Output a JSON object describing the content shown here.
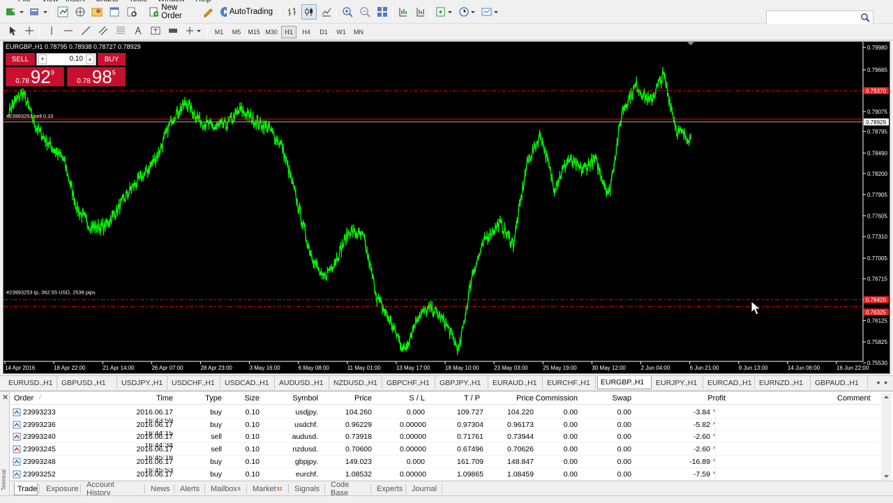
{
  "menu": [
    "File",
    "View",
    "Insert",
    "Charts",
    "Tools",
    "Window",
    "Help"
  ],
  "toolbar": {
    "new_order": "New Order",
    "auto_trading": "AutoTrading",
    "timeframes": [
      "M1",
      "M5",
      "M15",
      "M30",
      "H1",
      "H4",
      "D1",
      "W1",
      "MN"
    ],
    "active_timeframe": "H1"
  },
  "search": {
    "placeholder": ""
  },
  "chart": {
    "title": "EURGBP.,H1  0.78795 0.78938 0.78727 0.78929",
    "one_click": {
      "sell_label": "SELL",
      "buy_label": "BUY",
      "lot": "0.10",
      "sell_small": "0.78",
      "sell_big": "92",
      "sell_pip": "9",
      "buy_small": "0.78",
      "buy_big": "98",
      "buy_pip": "5"
    },
    "order_line_label": "#23993253 sell 0.10",
    "tp_line_label": "#23993253 tp, 362.55 USD, 2538 pips",
    "colors": {
      "background": "#000000",
      "candles": "#00ff00",
      "order_line": "#ff0000",
      "tp_line": "#ff0000",
      "bid_line": "#ffffff"
    }
  },
  "chart_data": {
    "type": "line",
    "title": "EURGBP.,H1",
    "y_ticks": [
      "0.79980",
      "0.79665",
      "0.79370",
      "0.79075",
      "0.78795",
      "0.78490",
      "0.78200",
      "0.77905",
      "0.77605",
      "0.77310",
      "0.77005",
      "0.76715",
      "0.76420",
      "0.76125",
      "0.75825",
      "0.75530"
    ],
    "x_ticks": [
      "14 Apr 2016",
      "18 Apr 22:00",
      "21 Apr 14:00",
      "26 Apr 07:00",
      "28 Apr 23:00",
      "3 May 16:00",
      "6 May 08:00",
      "11 May 01:00",
      "13 May 17:00",
      "18 May 10:00",
      "23 May 03:00",
      "25 May 19:00",
      "30 May 12:00",
      "2 Jun 04:00",
      "6 Jun 21:00",
      "9 Jun 13:00",
      "14 Jun 06:00",
      "16 Jun 22:00"
    ],
    "price_labels": {
      "order": "0.79370",
      "bid": "0.78929",
      "tp1": "0.76420",
      "tp2": "0.76325"
    },
    "series": [
      {
        "values": [
          0.791,
          0.7935,
          0.7885,
          0.786,
          0.784,
          0.777,
          0.7745,
          0.7745,
          0.777,
          0.78,
          0.782,
          0.785,
          0.79,
          0.792,
          0.7895,
          0.7885,
          0.789,
          0.791,
          0.7895,
          0.7885,
          0.786,
          0.779,
          0.7715,
          0.767,
          0.77,
          0.774,
          0.773,
          0.7645,
          0.761,
          0.757,
          0.762,
          0.763,
          0.761,
          0.757,
          0.768,
          0.773,
          0.775,
          0.772,
          0.7835,
          0.7875,
          0.78,
          0.784,
          0.7825,
          0.784,
          0.779,
          0.791,
          0.7945,
          0.792,
          0.796,
          0.788,
          0.787
        ]
      }
    ],
    "ylim": [
      0.7553,
      0.8
    ]
  },
  "chart_tabs": [
    "EURUSD.,H1",
    "GBPUSD.,H1",
    "USDJPY.,H1",
    "USDCHF.,H1",
    "USDCAD.,H1",
    "AUDUSD.,H1",
    "NZDUSD.,H1",
    "GBPCHF.,H1",
    "GBPJPY.,H1",
    "EURAUD.,H1",
    "EURCHF.,H1",
    "EURGBP.,H1",
    "EURJPY.,H1",
    "EURCAD.,H1",
    "EURNZD.,H1",
    "GBPAUD.,H1"
  ],
  "active_chart_tab": "EURGBP.,H1",
  "terminal": {
    "side_label": "Terminal",
    "columns": [
      "Order",
      "Time",
      "Type",
      "Size",
      "Symbol",
      "Price",
      "S / L",
      "T / P",
      "Price",
      "Commission",
      "Swap",
      "Profit",
      "Comment"
    ],
    "rows": [
      {
        "order": "23993233",
        "time": "2016.06.17 16:43:59",
        "type": "buy",
        "size": "0.10",
        "symbol": "usdjpy.",
        "price": "104.260",
        "sl": "0.000",
        "tp": "109.727",
        "cur": "104.220",
        "commission": "0.00",
        "swap": "0.00",
        "profit": "-3.84"
      },
      {
        "order": "23993236",
        "time": "2016.06.17 16:44:15",
        "type": "buy",
        "size": "0.10",
        "symbol": "usdchf.",
        "price": "0.96229",
        "sl": "0.00000",
        "tp": "0.97304",
        "cur": "0.96173",
        "commission": "0.00",
        "swap": "0.00",
        "profit": "-5.82"
      },
      {
        "order": "23993240",
        "time": "2016.06.17 16:44:34",
        "type": "sell",
        "size": "0.10",
        "symbol": "audusd.",
        "price": "0.73918",
        "sl": "0.00000",
        "tp": "0.71761",
        "cur": "0.73944",
        "commission": "0.00",
        "swap": "0.00",
        "profit": "-2.60"
      },
      {
        "order": "23993245",
        "time": "2016.06.17 16:45:18",
        "type": "sell",
        "size": "0.10",
        "symbol": "nzdusd.",
        "price": "0.70600",
        "sl": "0.00000",
        "tp": "0.67496",
        "cur": "0.70626",
        "commission": "0.00",
        "swap": "0.00",
        "profit": "-2.60"
      },
      {
        "order": "23993248",
        "time": "2016.06.17 16:45:53",
        "type": "buy",
        "size": "0.10",
        "symbol": "gbpjpy.",
        "price": "149.023",
        "sl": "0.000",
        "tp": "161.709",
        "cur": "148.847",
        "commission": "0.00",
        "swap": "0.00",
        "profit": "-16.89"
      },
      {
        "order": "23993252",
        "time": "2016.06.17 16:46:38",
        "type": "buy",
        "size": "0.10",
        "symbol": "eurchf.",
        "price": "1.08532",
        "sl": "0.00000",
        "tp": "1.09865",
        "cur": "1.08459",
        "commission": "0.00",
        "swap": "0.00",
        "profit": "-7.59"
      }
    ],
    "tabs": [
      {
        "label": "Trade",
        "badge": ""
      },
      {
        "label": "Exposure",
        "badge": ""
      },
      {
        "label": "Account History",
        "badge": ""
      },
      {
        "label": "News",
        "badge": ""
      },
      {
        "label": "Alerts",
        "badge": ""
      },
      {
        "label": "Mailbox",
        "badge": "8"
      },
      {
        "label": "Market",
        "badge": "52"
      },
      {
        "label": "Signals",
        "badge": ""
      },
      {
        "label": "Code Base",
        "badge": ""
      },
      {
        "label": "Experts",
        "badge": ""
      },
      {
        "label": "Journal",
        "badge": ""
      }
    ],
    "active_tab": "Trade"
  }
}
